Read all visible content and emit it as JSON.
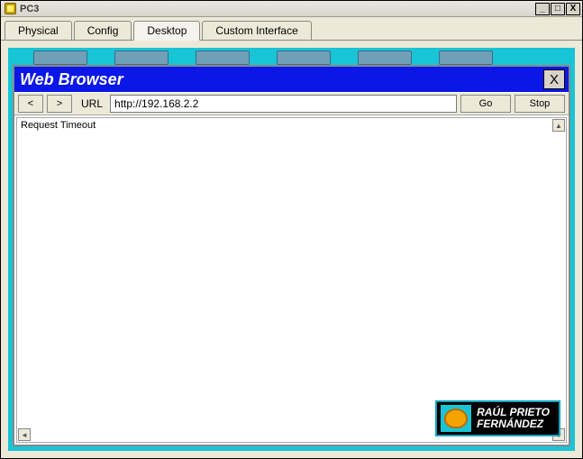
{
  "window": {
    "title": "PC3",
    "controls": {
      "min": "_",
      "max": "□",
      "close": "X"
    }
  },
  "tabs": [
    {
      "label": "Physical",
      "active": false
    },
    {
      "label": "Config",
      "active": false
    },
    {
      "label": "Desktop",
      "active": true
    },
    {
      "label": "Custom Interface",
      "active": false
    }
  ],
  "browser": {
    "title": "Web Browser",
    "close": "X",
    "back": "<",
    "forward": ">",
    "url_label": "URL",
    "url_value": "http://192.168.2.2",
    "go": "Go",
    "stop": "Stop",
    "content": "Request Timeout"
  },
  "watermark": {
    "line1": "RAÚL PRIETO",
    "line2": "FERNÁNDEZ"
  }
}
